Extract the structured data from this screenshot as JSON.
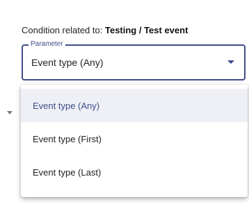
{
  "condition": {
    "prefix": "Condition related to:",
    "target": "Testing / Test event"
  },
  "parameter": {
    "legend": "Parameter",
    "value": "Event type (Any)"
  },
  "menu": {
    "items": [
      {
        "label": "Event type (Any)",
        "selected": true
      },
      {
        "label": "Event type (First)",
        "selected": false
      },
      {
        "label": "Event type (Last)",
        "selected": false
      }
    ]
  },
  "colors": {
    "accent": "#3f4c8a",
    "selected_bg": "#eef0f5"
  },
  "icons": {
    "field": "chevron-down-icon",
    "side": "chevron-down-icon"
  }
}
